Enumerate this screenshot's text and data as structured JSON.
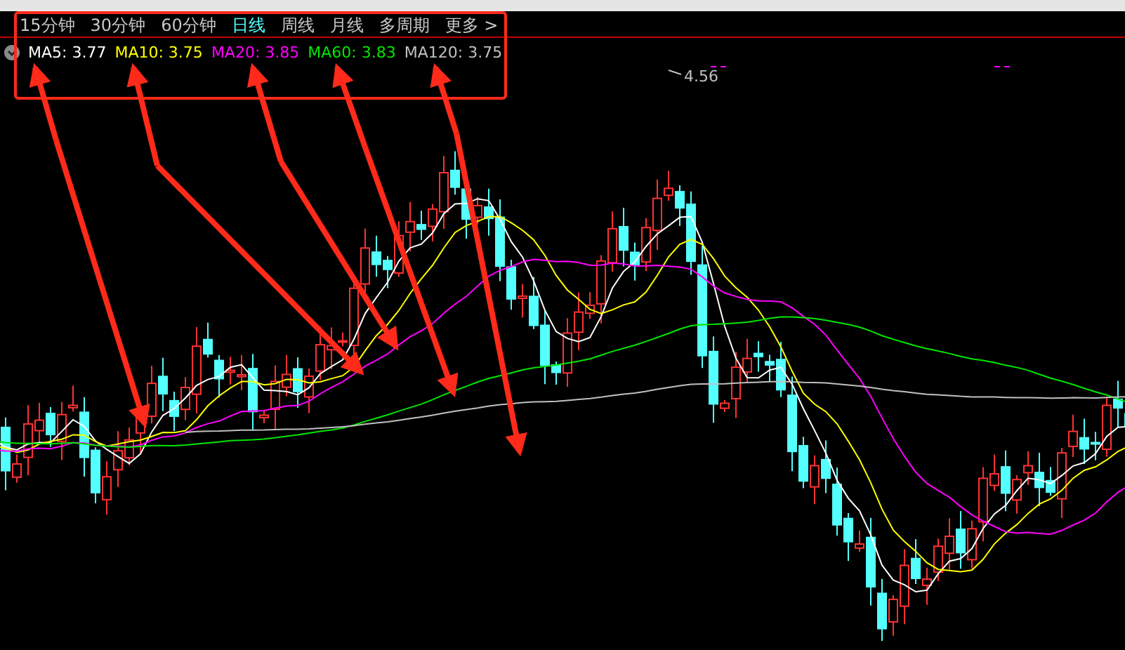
{
  "tabs": [
    {
      "label": "15分钟",
      "selected": false
    },
    {
      "label": "30分钟",
      "selected": false
    },
    {
      "label": "60分钟",
      "selected": false
    },
    {
      "label": "日线",
      "selected": true
    },
    {
      "label": "周线",
      "selected": false
    },
    {
      "label": "月线",
      "selected": false
    },
    {
      "label": "多周期",
      "selected": false
    },
    {
      "label": "更多 >",
      "selected": false
    }
  ],
  "moving_averages": [
    {
      "text": "MA5: 3.77",
      "color": "#ffffff"
    },
    {
      "text": "MA10: 3.75",
      "color": "#ffff00"
    },
    {
      "text": "MA20: 3.85",
      "color": "#ff00ff"
    },
    {
      "text": "MA60: 3.83",
      "color": "#00e600"
    },
    {
      "text": "MA120: 3.75",
      "color": "#c0c0c0"
    }
  ],
  "chart": {
    "high_label": "4.56"
  }
}
